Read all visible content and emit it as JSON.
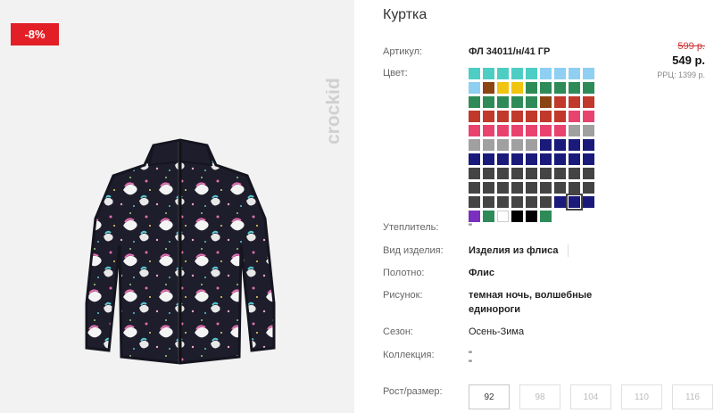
{
  "product": {
    "title": "Куртка",
    "discount_badge": "-8%",
    "brand": "crockid"
  },
  "price": {
    "old": "599 р.",
    "current": "549 р.",
    "rrp": "РРЦ: 1399 р."
  },
  "specs": {
    "article_label": "Артикул:",
    "article_value": "ФЛ 34011/н/41 ГР",
    "color_label": "Цвет:",
    "insulation_label": "Утеплитель:",
    "insulation_value": "\"",
    "type_label": "Вид изделия:",
    "type_value": "Изделия из флиса",
    "fabric_label": "Полотно:",
    "fabric_value": "Флис",
    "pattern_label": "Рисунок:",
    "pattern_value_1": "темная ночь, волшебные",
    "pattern_value_2": "единороги",
    "season_label": "Сезон:",
    "season_value": "Осень-Зима",
    "collection_label": "Коллекция:",
    "collection_value_1": "\"",
    "collection_value_2": "\"",
    "size_label": "Рост/размер:"
  },
  "colors": [
    "#4ecdc4",
    "#4ecdc4",
    "#4ecdc4",
    "#4ecdc4",
    "#4ecdc4",
    "#8ecff2",
    "#8ecff2",
    "#8ecff2",
    "#8ecff2",
    "#8ecff2",
    "#8b4513",
    "#f1c40f",
    "#f1c40f",
    "#2e8b57",
    "#2e8b57",
    "#2e8b57",
    "#2e8b57",
    "#2e8b57",
    "#2e8b57",
    "#2e8b57",
    "#2e8b57",
    "#2e8b57",
    "#2e8b57",
    "#8b4513",
    "#c0392b",
    "#c0392b",
    "#c0392b",
    "#c0392b",
    "#c0392b",
    "#c0392b",
    "#c0392b",
    "#c0392b",
    "#c0392b",
    "#c0392b",
    "#e8436e",
    "#e8436e",
    "#e8436e",
    "#e8436e",
    "#e8436e",
    "#e8436e",
    "#e8436e",
    "#e8436e",
    "#e8436e",
    "#a0a0a0",
    "#a0a0a0",
    "#a0a0a0",
    "#a0a0a0",
    "#a0a0a0",
    "#a0a0a0",
    "#a0a0a0",
    "#1a1a7a",
    "#1a1a7a",
    "#1a1a7a",
    "#1a1a7a",
    "#1a1a7a",
    "#1a1a7a",
    "#1a1a7a",
    "#1a1a7a",
    "#1a1a7a",
    "#1a1a7a",
    "#1a1a7a",
    "#1a1a7a",
    "#1a1a7a",
    "#444444",
    "#444444",
    "#444444",
    "#444444",
    "#444444",
    "#444444",
    "#444444",
    "#444444",
    "#444444",
    "#444444",
    "#444444",
    "#444444",
    "#444444",
    "#444444",
    "#444444",
    "#444444",
    "#444444",
    "#444444",
    "#444444",
    "#444444",
    "#444444",
    "#444444",
    "#444444",
    "#444444",
    "#1a1a7a",
    "#1a1a7a",
    "#1a1a7a",
    "#7b2fbe",
    "#2e8b57",
    "#ffffff",
    "#000000",
    "#000000",
    "#2e8b57"
  ],
  "selected_color_index": 88,
  "sizes": [
    {
      "label": "92",
      "active": true
    },
    {
      "label": "98",
      "active": false
    },
    {
      "label": "104",
      "active": false
    },
    {
      "label": "110",
      "active": false
    },
    {
      "label": "116",
      "active": false
    }
  ]
}
